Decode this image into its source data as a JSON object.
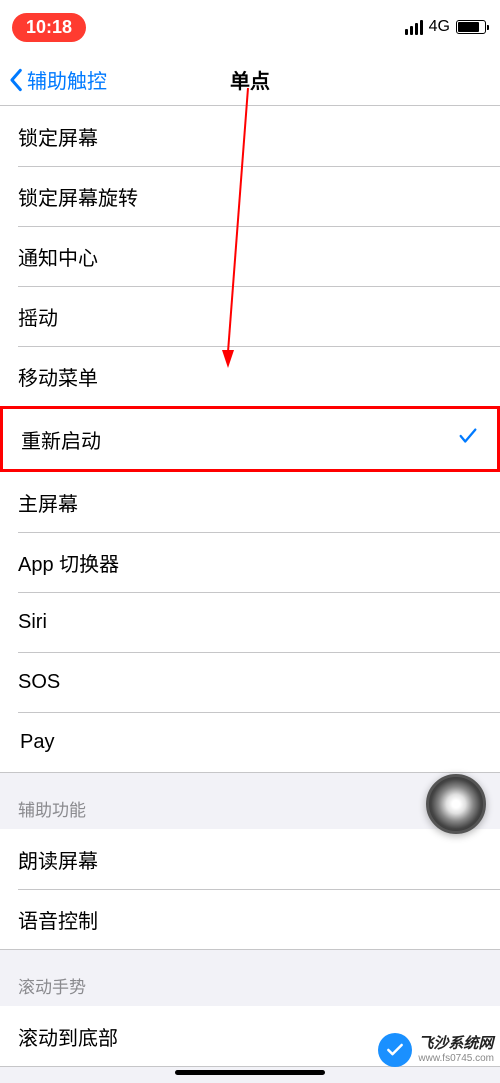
{
  "status": {
    "time": "10:18",
    "network": "4G"
  },
  "nav": {
    "back": "辅助触控",
    "title": "单点"
  },
  "group1": {
    "items": [
      {
        "label": "锁定屏幕",
        "selected": false
      },
      {
        "label": "锁定屏幕旋转",
        "selected": false
      },
      {
        "label": "通知中心",
        "selected": false
      },
      {
        "label": "摇动",
        "selected": false
      },
      {
        "label": "移动菜单",
        "selected": false
      },
      {
        "label": "重新启动",
        "selected": true,
        "highlight": true
      },
      {
        "label": "主屏幕",
        "selected": false
      },
      {
        "label": "App 切换器",
        "selected": false
      },
      {
        "label": "Siri",
        "selected": false
      },
      {
        "label": "SOS",
        "selected": false
      },
      {
        "label": "Pay",
        "selected": false,
        "apple_prefix": true
      }
    ]
  },
  "group2": {
    "header": "辅助功能",
    "items": [
      {
        "label": "朗读屏幕"
      },
      {
        "label": "语音控制"
      }
    ]
  },
  "group3": {
    "header": "滚动手势",
    "items": [
      {
        "label": "滚动到底部"
      }
    ]
  },
  "watermark": {
    "line1": "飞沙系统网",
    "line2": "www.fs0745.com"
  }
}
